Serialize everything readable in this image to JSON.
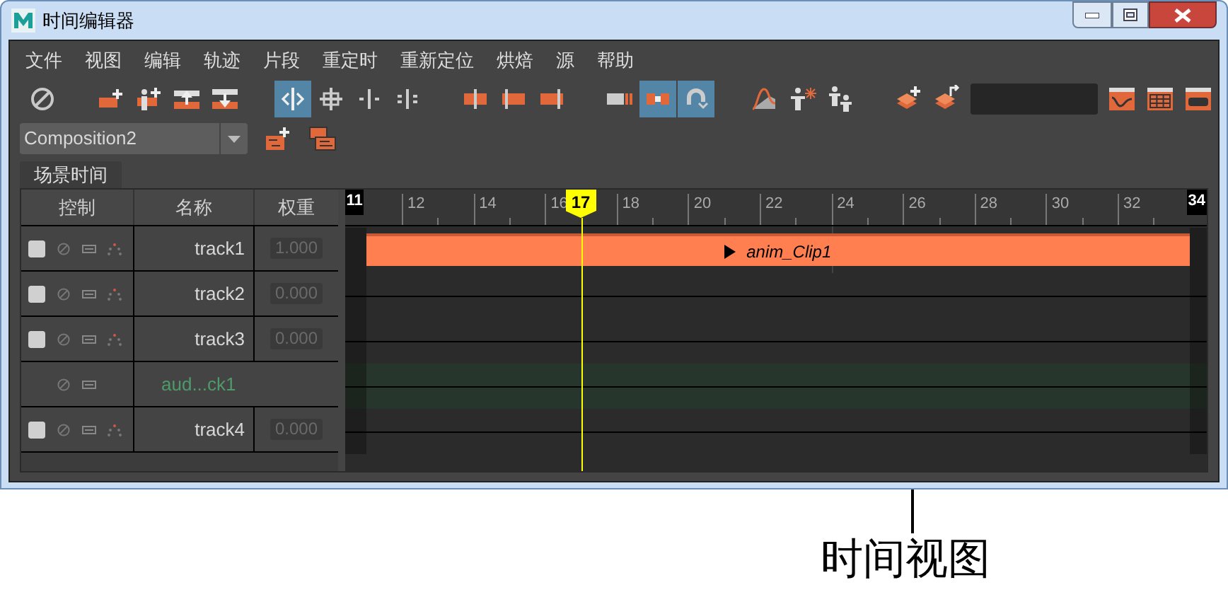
{
  "window": {
    "title": "时间编辑器"
  },
  "menu": [
    "文件",
    "视图",
    "编辑",
    "轨迹",
    "片段",
    "重定时",
    "重新定位",
    "烘焙",
    "源",
    "帮助"
  ],
  "toolbar_groups": [
    {
      "buttons": [
        {
          "kind": "mute",
          "selected": false
        }
      ]
    },
    {
      "buttons": [
        {
          "kind": "add-track",
          "selected": false
        },
        {
          "kind": "add-figure-track",
          "selected": false
        },
        {
          "kind": "move-up",
          "selected": false
        },
        {
          "kind": "move-down",
          "selected": false
        }
      ]
    },
    {
      "buttons": [
        {
          "kind": "slide",
          "selected": true
        },
        {
          "kind": "move",
          "selected": false
        },
        {
          "kind": "trim",
          "selected": false
        },
        {
          "kind": "split",
          "selected": false
        }
      ]
    },
    {
      "buttons": [
        {
          "kind": "clip-left",
          "selected": false
        },
        {
          "kind": "clip-center",
          "selected": false
        },
        {
          "kind": "clip-right",
          "selected": false
        }
      ]
    },
    {
      "buttons": [
        {
          "kind": "hold",
          "selected": false
        },
        {
          "kind": "loop",
          "selected": true
        },
        {
          "kind": "magnet",
          "selected": true
        }
      ]
    },
    {
      "buttons": [
        {
          "kind": "curve",
          "selected": false
        },
        {
          "kind": "figure-star",
          "selected": false
        },
        {
          "kind": "figures",
          "selected": false
        }
      ]
    },
    {
      "buttons": [
        {
          "kind": "layer-add",
          "selected": false
        },
        {
          "kind": "layer-export",
          "selected": false
        },
        {
          "kind": "field"
        },
        {
          "kind": "graph-window",
          "selected": false
        },
        {
          "kind": "grid-window",
          "selected": false
        },
        {
          "kind": "gamepad-window",
          "selected": false
        }
      ]
    }
  ],
  "composition": {
    "value": "Composition2"
  },
  "tabs": [
    {
      "label": "场景时间",
      "selected": true
    }
  ],
  "columns": [
    "控制",
    "名称",
    "权重"
  ],
  "tracks": [
    {
      "kind": "anim",
      "name": "track1",
      "weight": "1.000",
      "checked": false,
      "clips": [
        "anim_Clip1"
      ]
    },
    {
      "kind": "anim",
      "name": "track2",
      "weight": "0.000",
      "checked": false
    },
    {
      "kind": "anim",
      "name": "track3",
      "weight": "0.000",
      "checked": false
    },
    {
      "kind": "audio",
      "name": "aud...ck1"
    },
    {
      "kind": "anim",
      "name": "track4",
      "weight": "0.000",
      "checked": false
    }
  ],
  "ruler": {
    "start": "11",
    "labels": [
      "12",
      "14",
      "16",
      "18",
      "20",
      "22",
      "24",
      "26",
      "28",
      "30",
      "32"
    ],
    "end": "34",
    "playhead": "17"
  },
  "callout": "时间视图"
}
